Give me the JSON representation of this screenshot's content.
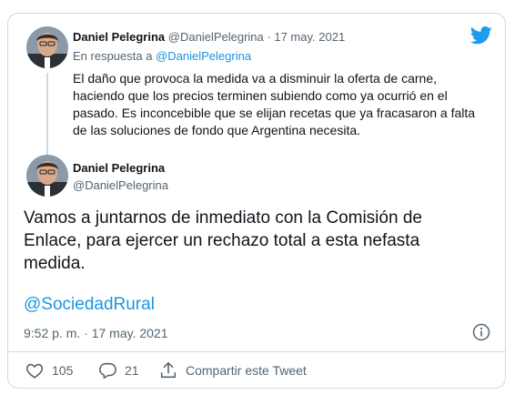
{
  "colors": {
    "accent": "#1b95e0",
    "muted": "#536471",
    "border": "#cfd9de",
    "text": "#0f1419"
  },
  "reply_tweet": {
    "author_name": "Daniel Pelegrina",
    "author_handle": "@DanielPelegrina",
    "separator": "·",
    "date": "17 may. 2021",
    "reply_prefix": "En respuesta a",
    "reply_to": "@DanielPelegrina",
    "text": "El daño que provoca la medida va a disminuir la oferta de carne, haciendo que los precios terminen subiendo como ya ocurrió en el pasado. Es inconcebible que se elijan recetas que ya fracasaron a falta de las soluciones de fondo que Argentina necesita."
  },
  "main_tweet": {
    "author_name": "Daniel Pelegrina",
    "author_handle": "@DanielPelegrina",
    "text": "Vamos a juntarnos de inmediato con la Comisión de Enlace, para ejercer un rechazo total a esta nefasta medida.",
    "mention": "@SociedadRural",
    "timestamp": "9:52 p. m. · 17 may. 2021"
  },
  "actions": {
    "likes": "105",
    "replies": "21",
    "share_label": "Compartir este Tweet"
  },
  "icons": [
    "twitter-bird-icon",
    "info-icon",
    "heart-icon",
    "reply-icon",
    "share-icon"
  ]
}
